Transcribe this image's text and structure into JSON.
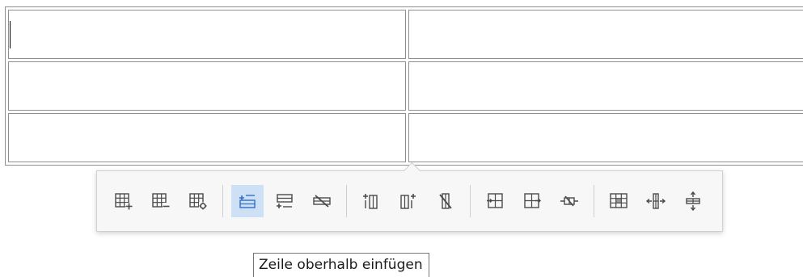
{
  "table": {
    "rows": [
      [
        "",
        ""
      ],
      [
        "",
        ""
      ],
      [
        "",
        ""
      ]
    ]
  },
  "toolbar": {
    "groups": [
      [
        {
          "name": "table-insert-icon",
          "label": "Tabelle einfügen"
        },
        {
          "name": "table-delete-icon",
          "label": "Tabelle löschen"
        },
        {
          "name": "table-properties-icon",
          "label": "Tabelleneigenschaften"
        }
      ],
      [
        {
          "name": "row-insert-above-icon",
          "label": "Zeile oberhalb einfügen",
          "active": true
        },
        {
          "name": "row-insert-below-icon",
          "label": "Zeile unterhalb einfügen"
        },
        {
          "name": "row-delete-icon",
          "label": "Zeile löschen"
        }
      ],
      [
        {
          "name": "column-insert-before-icon",
          "label": "Spalte davor einfügen"
        },
        {
          "name": "column-insert-after-icon",
          "label": "Spalte danach einfügen"
        },
        {
          "name": "column-delete-icon",
          "label": "Spalte löschen"
        }
      ],
      [
        {
          "name": "cell-merge-icon",
          "label": "Zellen verbinden"
        },
        {
          "name": "cell-split-icon",
          "label": "Zellen teilen"
        },
        {
          "name": "cell-delete-icon",
          "label": "Zelle löschen"
        }
      ],
      [
        {
          "name": "cell-properties-icon",
          "label": "Zelleneigenschaften"
        },
        {
          "name": "column-resize-icon",
          "label": "Spaltenbreite"
        },
        {
          "name": "row-resize-icon",
          "label": "Zeilenhöhe"
        }
      ]
    ]
  },
  "tooltip": {
    "text": "Zeile oberhalb einfügen"
  },
  "colors": {
    "icon": "#4a4a4a",
    "accent": "#2e6fc9",
    "active_bg": "#cde0f5",
    "border": "#8f8f8f"
  }
}
